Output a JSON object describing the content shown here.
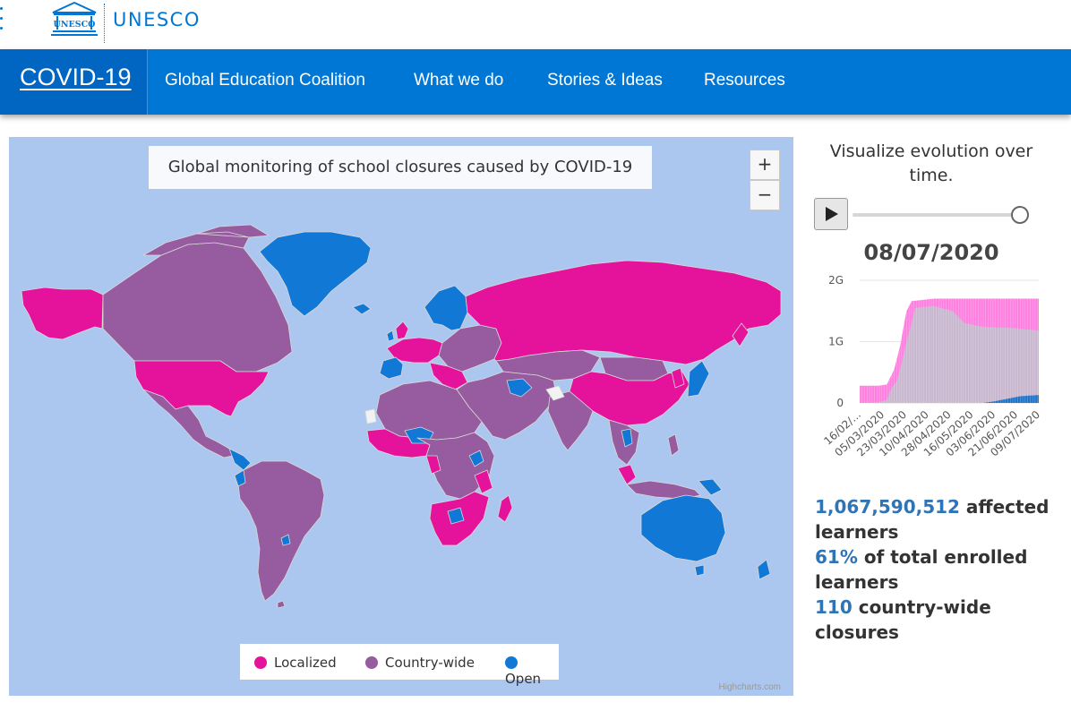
{
  "brand": {
    "name": "UNESCO",
    "logo_text": "UNESCO"
  },
  "nav": {
    "home": "COVID-19",
    "items": [
      "Global Education Coalition",
      "What we do",
      "Stories & Ideas",
      "Resources"
    ]
  },
  "map": {
    "title": "Global monitoring of school closures caused by COVID-19",
    "zoom_in": "+",
    "zoom_out": "−",
    "legend": [
      {
        "label": "Localized",
        "color": "#e5139c"
      },
      {
        "label": "Country-wide",
        "color": "#975b9f"
      },
      {
        "label": "Open",
        "color": "#1278d6"
      }
    ],
    "credits": "Highcharts.com",
    "colors": {
      "ocean": "#abc7ef",
      "border": "#d8d8d8"
    }
  },
  "side": {
    "title": "Visualize evolution over time.",
    "date": "08/07/2020",
    "stats": {
      "learners_num": "1,067,590,512",
      "learners_text": " affected learners",
      "pct_num": "61%",
      "pct_text": " of total enrolled learners",
      "closures_num": "110",
      "closures_text": " country-wide closures"
    }
  },
  "chart_data": {
    "type": "area",
    "title": "",
    "y_ticks": [
      "0",
      "1G",
      "2G"
    ],
    "ylim": [
      0,
      2
    ],
    "x_tick_labels": [
      "16/02/...",
      "05/03/2020",
      "23/03/2020",
      "10/04/2020",
      "28/04/2020",
      "16/05/2020",
      "03/06/2020",
      "21/06/2020",
      "09/07/2020"
    ],
    "x_tick_index": [
      0,
      19,
      37,
      55,
      73,
      91,
      109,
      127,
      145
    ],
    "x_count": 146,
    "series": [
      {
        "name": "Localized",
        "color": "#ff7fe0",
        "points": [
          [
            0,
            0.28
          ],
          [
            15,
            0.28
          ],
          [
            22,
            0.3
          ],
          [
            28,
            0.55
          ],
          [
            33,
            0.95
          ],
          [
            36,
            1.3
          ],
          [
            38,
            1.5
          ],
          [
            42,
            1.66
          ],
          [
            60,
            1.7
          ],
          [
            110,
            1.7
          ],
          [
            145,
            1.7
          ]
        ]
      },
      {
        "name": "Country-wide",
        "color": "#c8b7cf",
        "points": [
          [
            0,
            0.0
          ],
          [
            15,
            0.01
          ],
          [
            22,
            0.05
          ],
          [
            26,
            0.25
          ],
          [
            30,
            0.35
          ],
          [
            34,
            0.65
          ],
          [
            38,
            1.0
          ],
          [
            42,
            1.3
          ],
          [
            45,
            1.55
          ],
          [
            60,
            1.58
          ],
          [
            75,
            1.5
          ],
          [
            85,
            1.3
          ],
          [
            100,
            1.24
          ],
          [
            125,
            1.22
          ],
          [
            145,
            1.18
          ]
        ]
      },
      {
        "name": "Open",
        "color": "#1f73c8",
        "points": [
          [
            0,
            0.0
          ],
          [
            100,
            0.0
          ],
          [
            110,
            0.03
          ],
          [
            120,
            0.07
          ],
          [
            130,
            0.11
          ],
          [
            145,
            0.13
          ]
        ]
      }
    ]
  }
}
